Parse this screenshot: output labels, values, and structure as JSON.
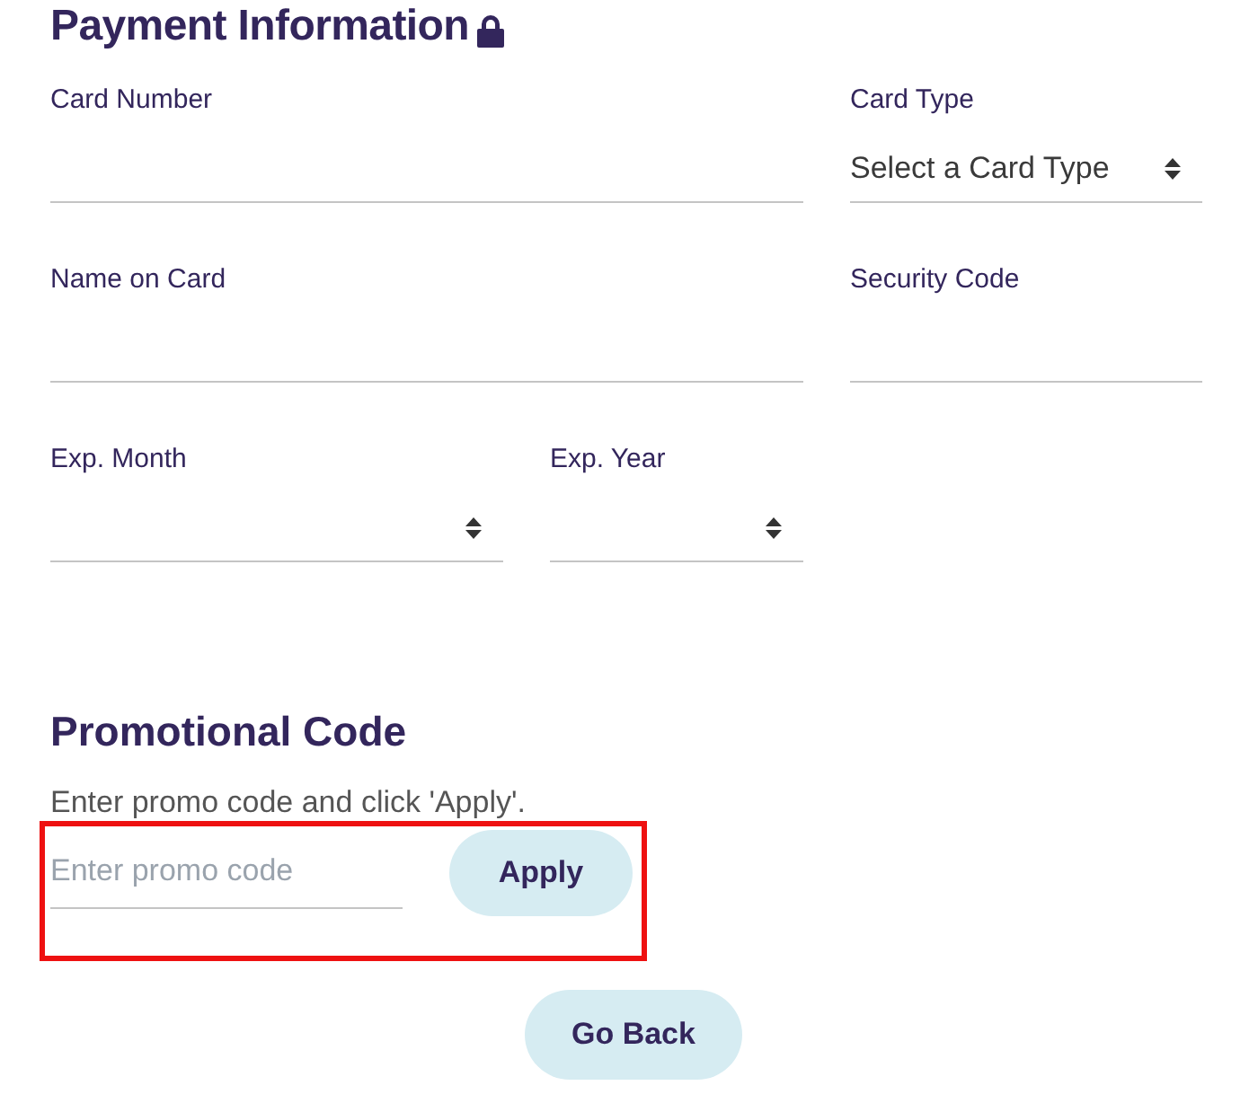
{
  "payment": {
    "title": "Payment Information",
    "fields": [
      {
        "label": "Card Number",
        "kind": "text"
      },
      {
        "label": "Card Type",
        "kind": "select",
        "value": "Select a Card Type"
      },
      {
        "label": "Name on Card",
        "kind": "text"
      },
      {
        "label": "Security Code",
        "kind": "text"
      },
      {
        "label": "Exp. Month",
        "kind": "select"
      },
      {
        "label": "Exp. Year",
        "kind": "select"
      }
    ]
  },
  "promo": {
    "title": "Promotional Code",
    "instructions": "Enter promo code and click 'Apply'.",
    "placeholder": "Enter promo code",
    "button": "Apply",
    "highlighted": true
  },
  "back_button": "Go Back"
}
